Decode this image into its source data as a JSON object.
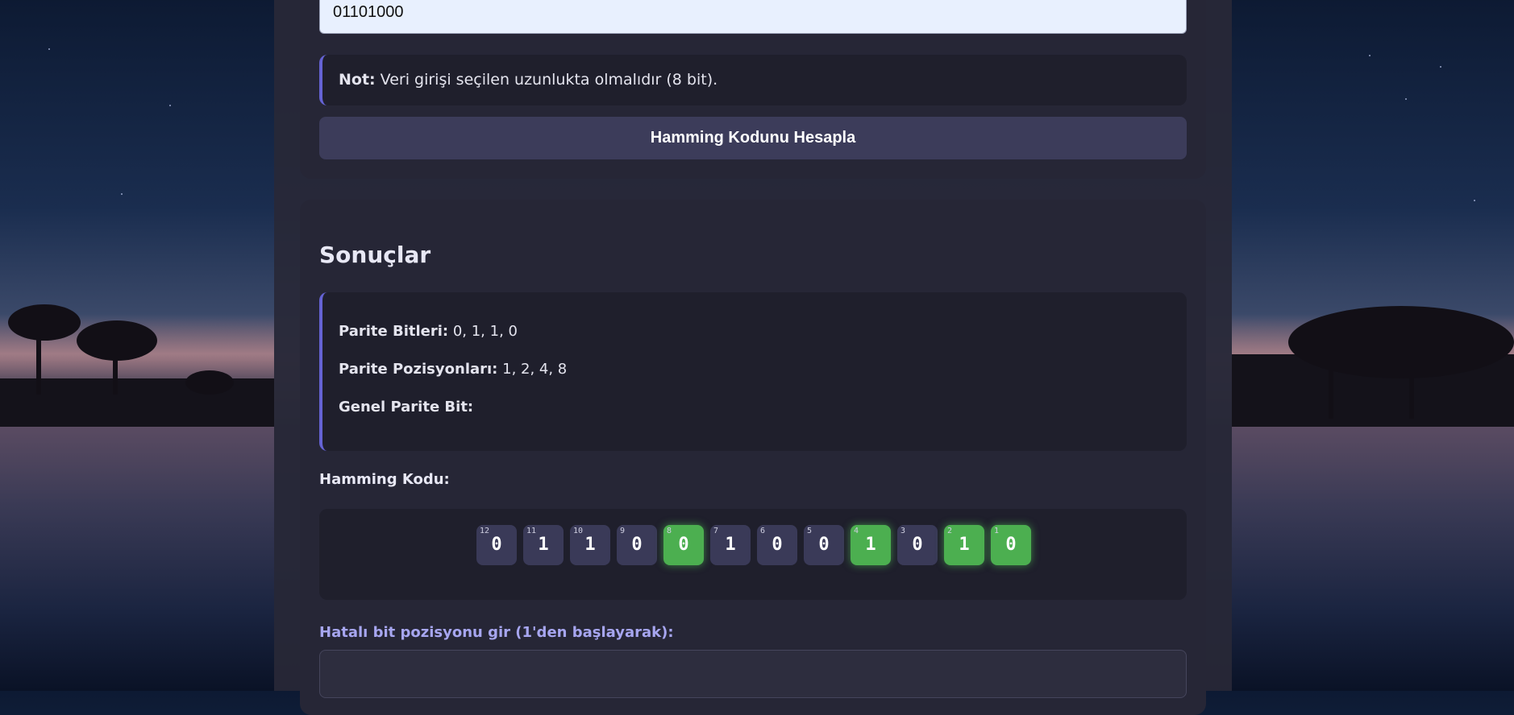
{
  "input": {
    "value": "01101000"
  },
  "note": {
    "label": "Not:",
    "text": " Veri girişi seçilen uzunlukta olmalıdır (8 bit)."
  },
  "calculate_button": {
    "label": "Hamming Kodunu Hesapla"
  },
  "results": {
    "title": "Sonuçlar",
    "parity_bits": {
      "label": "Parite Bitleri:",
      "value": " 0, 1, 1, 0"
    },
    "parity_positions": {
      "label": "Parite Pozisyonları:",
      "value": " 1, 2, 4, 8"
    },
    "overall_parity": {
      "label": "Genel Parite Bit:",
      "value": ""
    },
    "hamming_label": "Hamming Kodu:",
    "bits": [
      {
        "pos": "12",
        "val": "0",
        "parity": false
      },
      {
        "pos": "11",
        "val": "1",
        "parity": false
      },
      {
        "pos": "10",
        "val": "1",
        "parity": false
      },
      {
        "pos": "9",
        "val": "0",
        "parity": false
      },
      {
        "pos": "8",
        "val": "0",
        "parity": true
      },
      {
        "pos": "7",
        "val": "1",
        "parity": false
      },
      {
        "pos": "6",
        "val": "0",
        "parity": false
      },
      {
        "pos": "5",
        "val": "0",
        "parity": false
      },
      {
        "pos": "4",
        "val": "1",
        "parity": true
      },
      {
        "pos": "3",
        "val": "0",
        "parity": false
      },
      {
        "pos": "2",
        "val": "1",
        "parity": true
      },
      {
        "pos": "1",
        "val": "0",
        "parity": true
      }
    ],
    "error_label": "Hatalı bit pozisyonu gir (1'den başlayarak):",
    "error_input_value": ""
  },
  "colors": {
    "accent": "#6563d4",
    "parity_bit": "#4caf50",
    "data_bit": "#3a3a58"
  }
}
